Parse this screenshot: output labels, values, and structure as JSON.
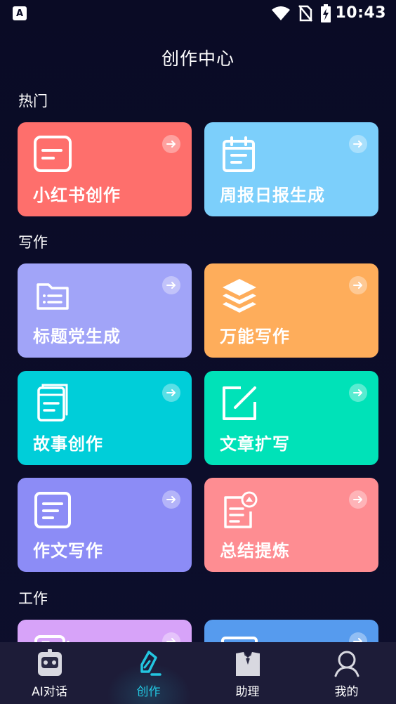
{
  "status_bar": {
    "app_icon_letter": "A",
    "time": "10:43"
  },
  "header": {
    "title": "创作中心"
  },
  "sections": {
    "hot": "热门",
    "writing": "写作",
    "work": "工作"
  },
  "cards": {
    "xiaohongshu": {
      "label": "小红书创作",
      "color": "#fe6f6c",
      "icon": "note-icon"
    },
    "weekly_report": {
      "label": "周报日报生成",
      "color": "#7ccffb",
      "icon": "calendar-icon"
    },
    "headline": {
      "label": "标题党生成",
      "color": "#a1a4f8",
      "icon": "folder-list-icon"
    },
    "universal": {
      "label": "万能写作",
      "color": "#fead5b",
      "icon": "layers-icon"
    },
    "story": {
      "label": "故事创作",
      "color": "#00ced9",
      "icon": "book-icon"
    },
    "article_expand": {
      "label": "文章扩写",
      "color": "#00e2b8",
      "icon": "edit-icon"
    },
    "essay": {
      "label": "作文写作",
      "color": "#8c8cf6",
      "icon": "document-icon"
    },
    "summary": {
      "label": "总结提炼",
      "color": "#fe8d92",
      "icon": "summary-icon"
    },
    "work1": {
      "label": "",
      "color": "#d7a3f9",
      "icon": "chat-icon"
    },
    "work2": {
      "label": "",
      "color": "#569bee",
      "icon": "monitor-icon"
    }
  },
  "bottom_nav": {
    "items": [
      {
        "label": "AI对话",
        "icon": "robot-icon"
      },
      {
        "label": "创作",
        "icon": "pen-icon",
        "active": true
      },
      {
        "label": "助理",
        "icon": "suit-icon"
      },
      {
        "label": "我的",
        "icon": "user-icon"
      }
    ]
  },
  "colors": {
    "background": "#0b0c26",
    "nav_background": "#1d1c38",
    "accent": "#23c6e0"
  }
}
